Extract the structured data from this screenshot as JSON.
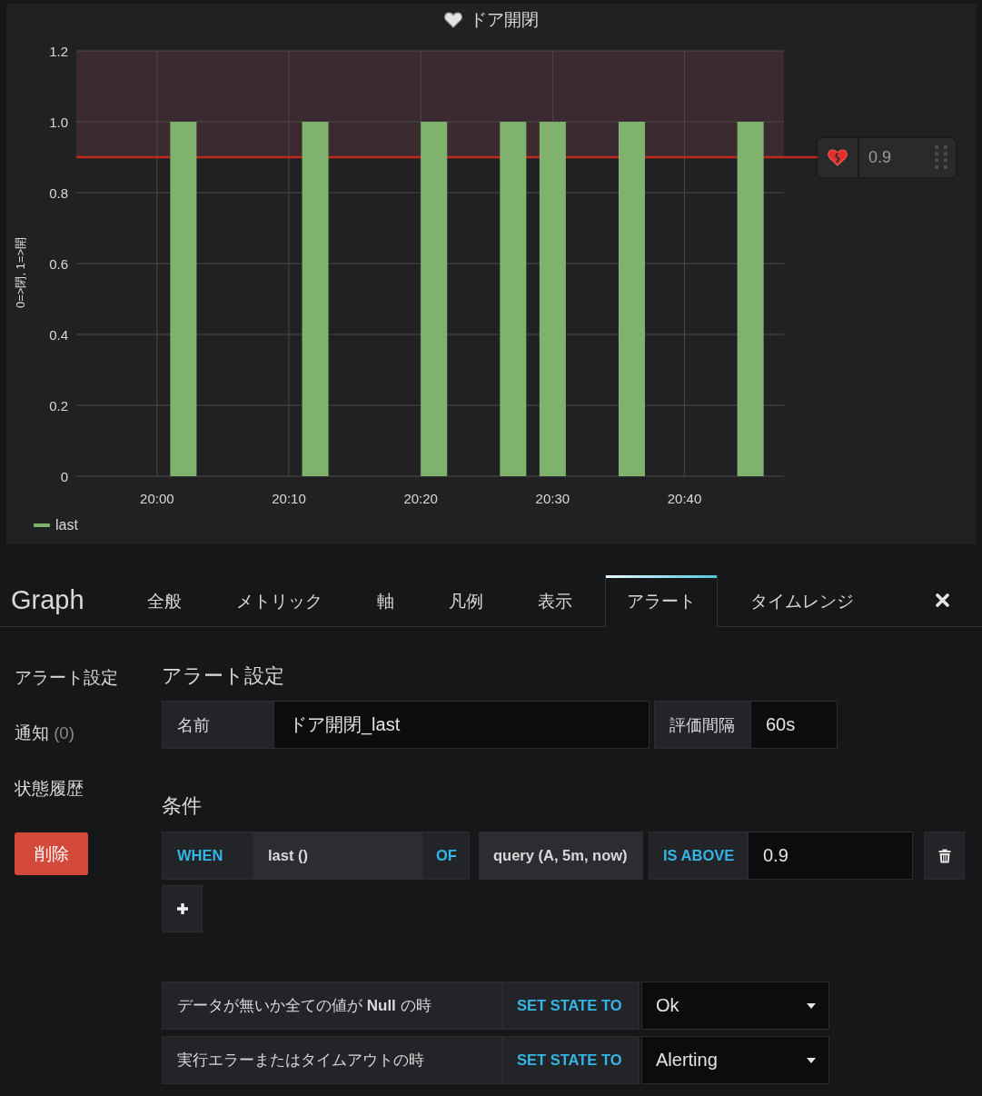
{
  "chart_panel": {
    "chart_data": {
      "type": "bar",
      "title": "ドア開閉",
      "ylabel": "0=>閉, 1=>開",
      "grid": true,
      "categories": [
        null,
        null,
        null,
        null,
        null,
        null,
        "20:00",
        null,
        null,
        null,
        null,
        null,
        null,
        null,
        null,
        null,
        "20:10",
        null,
        null,
        null,
        null,
        null,
        null,
        null,
        null,
        null,
        "20:20",
        null,
        null,
        null,
        null,
        null,
        null,
        null,
        null,
        null,
        "20:30",
        null,
        null,
        null,
        null,
        null,
        null,
        null,
        null,
        null,
        "20:40",
        null,
        null,
        null,
        null,
        null,
        null,
        null
      ],
      "series": [
        {
          "name": "last",
          "color": "#7eb26d",
          "values": [
            null,
            null,
            null,
            null,
            null,
            null,
            null,
            null,
            1,
            null,
            null,
            null,
            null,
            null,
            null,
            null,
            null,
            null,
            1,
            null,
            null,
            null,
            null,
            null,
            null,
            null,
            null,
            1,
            null,
            null,
            null,
            null,
            null,
            1,
            null,
            null,
            1,
            null,
            null,
            null,
            null,
            null,
            1,
            null,
            null,
            null,
            null,
            null,
            null,
            null,
            null,
            1,
            null,
            null
          ]
        }
      ],
      "ylim": [
        0,
        1.2
      ],
      "yticks": [
        0,
        0.2,
        0.4,
        0.6,
        0.8,
        {
          "value": 1,
          "label": "1.0"
        },
        1.2
      ],
      "bands": [
        {
          "axis": "y",
          "from": 0.9,
          "to": 1.2
        }
      ],
      "ref_lines": [
        {
          "axis": "y",
          "value": 0.9
        }
      ]
    },
    "threshold_handle": {
      "value": "0.9"
    }
  },
  "editor": {
    "title": "Graph",
    "tabs": [
      {
        "label": "全般",
        "selected": false
      },
      {
        "label": "メトリック",
        "selected": false
      },
      {
        "label": "軸",
        "selected": false
      },
      {
        "label": "凡例",
        "selected": false
      },
      {
        "label": "表示",
        "selected": false
      },
      {
        "label": "アラート",
        "selected": true
      },
      {
        "label": "タイムレンジ",
        "selected": false
      }
    ]
  },
  "side_nav": {
    "items": [
      {
        "label": "アラート設定"
      },
      {
        "label": "通知",
        "count": "(0)"
      },
      {
        "label": "状態履歴"
      }
    ],
    "delete_button": "削除"
  },
  "alert_settings": {
    "heading": "アラート設定",
    "fields": [
      {
        "label": "名前",
        "value": "ドア開閉_last"
      },
      {
        "label": "評価間隔",
        "value": "60s"
      }
    ]
  },
  "conditions": {
    "heading": "条件",
    "rows": [
      {
        "operator": "WHEN",
        "reducer": "last ()",
        "of": "OF",
        "query": "query (A, 5m, now)",
        "evaluator": "IS ABOVE",
        "threshold": "0.9"
      }
    ]
  },
  "state_rules": [
    {
      "label": "データが無いか全ての値が **Null** の時",
      "action": "SET STATE TO",
      "state": "Ok"
    },
    {
      "label": "実行エラーまたはタイムアウトの時",
      "action": "SET STATE TO",
      "state": "Alerting"
    }
  ]
}
